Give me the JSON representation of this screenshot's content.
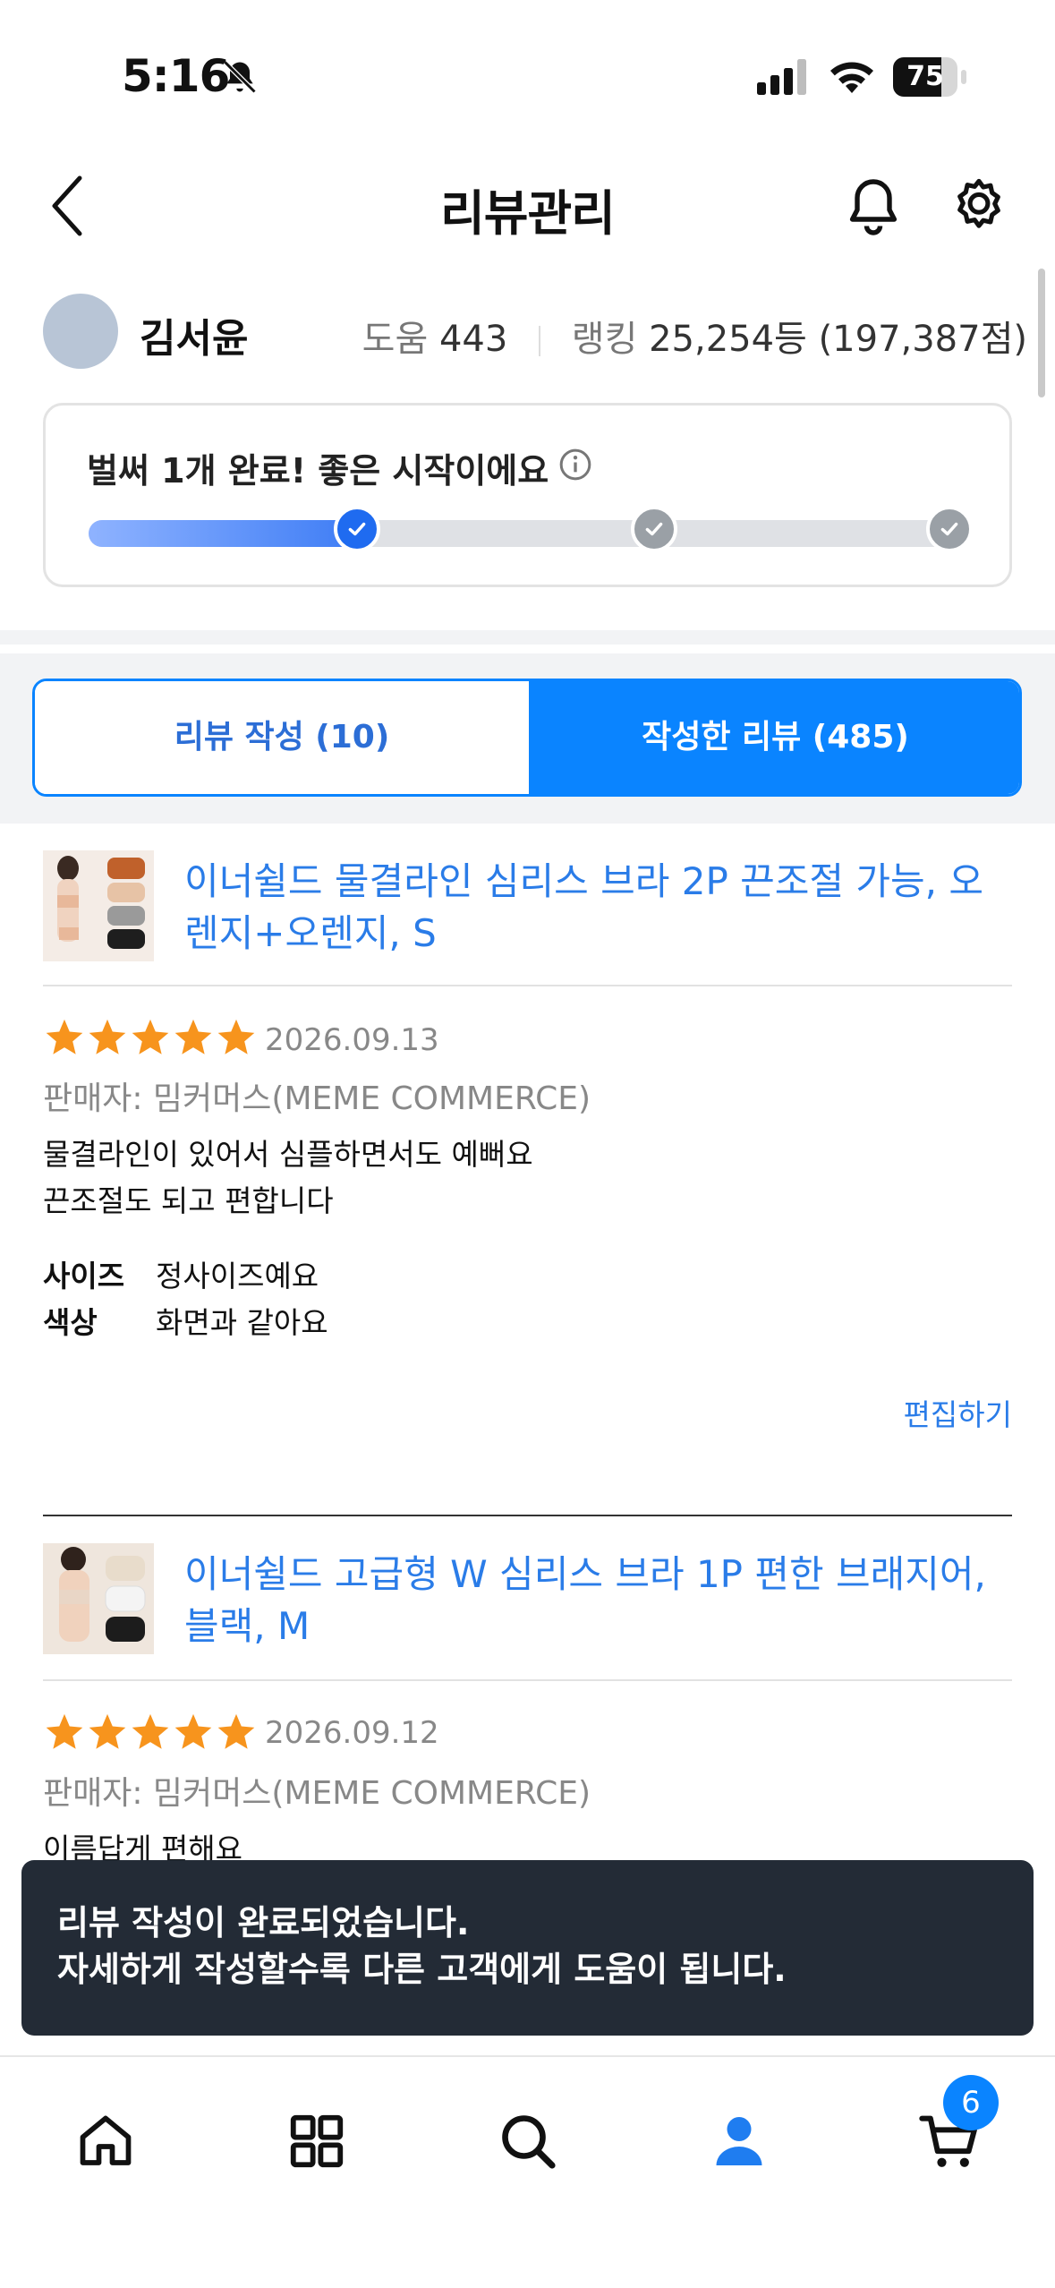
{
  "status_bar": {
    "time": "5:16",
    "battery": "75",
    "battery_level_percent": 75,
    "icons": [
      "bell-off-icon",
      "signal-icon",
      "wifi-icon",
      "battery-icon"
    ]
  },
  "header": {
    "title": "리뷰관리",
    "icons": [
      "back-arrow-icon",
      "bell-icon",
      "gear-icon"
    ]
  },
  "profile": {
    "name": "김서윤",
    "help_label": "도움",
    "help_value": "443",
    "rank_label": "랭킹",
    "rank_value": "25,254등 (197,387점)"
  },
  "progress": {
    "title": "벌써 1개 완료! 좋은 시작이에요",
    "completed_steps": 1,
    "total_steps": 3,
    "fill_fraction": 0.31
  },
  "tabs": {
    "write": "리뷰 작성 (10)",
    "written": "작성한 리뷰 (485)",
    "active": "written"
  },
  "reviews": [
    {
      "product_name": "이너쉴드 물결라인 심리스 브라 2P 끈조절 가능, 오렌지+오렌지, S",
      "rating": 5,
      "date": "2026.09.13",
      "seller": "판매자: 밈커머스(MEME COMMERCE)",
      "body": "물결라인이 있어서 심플하면서도 예뻐요\n끈조절도 되고 편합니다",
      "attributes": [
        {
          "key": "사이즈",
          "value": "정사이즈예요"
        },
        {
          "key": "색상",
          "value": "화면과 같아요"
        }
      ],
      "edit_label": "편집하기"
    },
    {
      "product_name": "이너쉴드 고급형 W 심리스 브라 1P 편한 브래지어, 블랙, M",
      "rating": 5,
      "date": "2026.09.12",
      "seller": "판매자: 밈커머스(MEME COMMERCE)",
      "body": "이름답게 편해요"
    }
  ],
  "toast": {
    "line1": "리뷰 작성이 완료되었습니다.",
    "line2": "자세하게 작성할수록 다른 고객에게 도움이 됩니다."
  },
  "bottom_nav": {
    "items": [
      "home-icon",
      "grid-icon",
      "search-icon",
      "user-icon",
      "cart-icon"
    ],
    "active": "user-icon",
    "cart_badge": "6"
  },
  "colors": {
    "accent": "#0a84ff",
    "link": "#2a7ce8",
    "star": "#f7941d",
    "toast_bg": "#232b36"
  }
}
